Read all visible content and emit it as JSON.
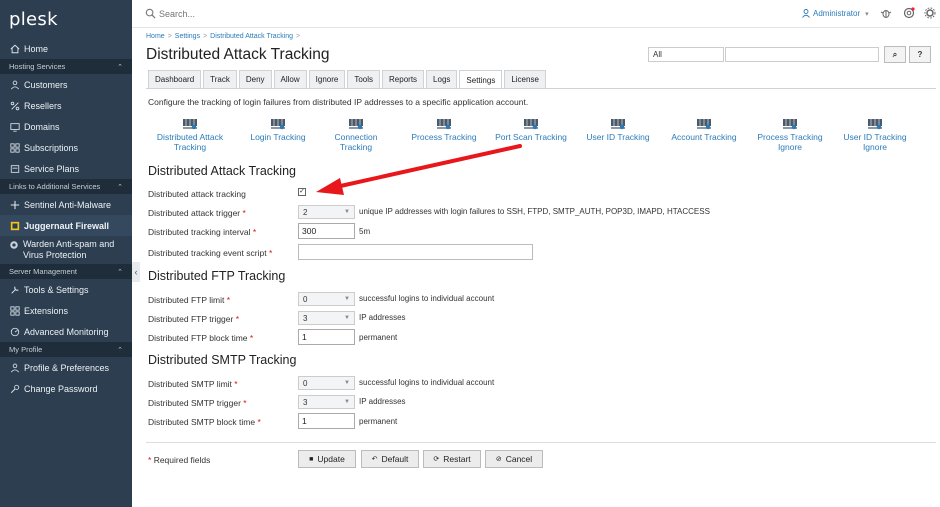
{
  "sidebar": {
    "logo": "plesk",
    "items": [
      {
        "type": "item",
        "label": "Home",
        "icon": "home-icon"
      },
      {
        "type": "section",
        "label": "Hosting Services"
      },
      {
        "type": "item",
        "label": "Customers",
        "icon": "user-icon"
      },
      {
        "type": "item",
        "label": "Resellers",
        "icon": "percent-icon"
      },
      {
        "type": "item",
        "label": "Domains",
        "icon": "monitor-icon"
      },
      {
        "type": "item",
        "label": "Subscriptions",
        "icon": "grid-icon"
      },
      {
        "type": "item",
        "label": "Service Plans",
        "icon": "document-icon"
      },
      {
        "type": "section",
        "label": "Links to Additional Services"
      },
      {
        "type": "item",
        "label": "Sentinel Anti-Malware",
        "icon": "shield-icon"
      },
      {
        "type": "item",
        "label": "Juggernaut Firewall",
        "icon": "firewall-icon",
        "active": true
      },
      {
        "type": "item",
        "label": "Warden Anti-spam and Virus Protection",
        "icon": "warden-icon",
        "tall": true
      },
      {
        "type": "section",
        "label": "Server Management"
      },
      {
        "type": "item",
        "label": "Tools & Settings",
        "icon": "tools-icon"
      },
      {
        "type": "item",
        "label": "Extensions",
        "icon": "extensions-icon"
      },
      {
        "type": "item",
        "label": "Advanced Monitoring",
        "icon": "monitoring-icon"
      },
      {
        "type": "section",
        "label": "My Profile"
      },
      {
        "type": "item",
        "label": "Profile & Preferences",
        "icon": "profile-icon"
      },
      {
        "type": "item",
        "label": "Change Password",
        "icon": "key-icon"
      }
    ],
    "collapse_glyph": "‹"
  },
  "topbar": {
    "search_placeholder": "Search...",
    "user": "Administrator",
    "user_caret": "▾"
  },
  "breadcrumb": [
    "Home",
    "Settings",
    "Distributed Attack Tracking"
  ],
  "breadcrumb_sep": ">",
  "page_title": "Distributed Attack Tracking",
  "filter": {
    "select": "All",
    "search_btn": "⌕",
    "help_btn": "?"
  },
  "tabs": [
    "Dashboard",
    "Track",
    "Deny",
    "Allow",
    "Ignore",
    "Tools",
    "Reports",
    "Logs",
    "Settings",
    "License"
  ],
  "active_tab": "Settings",
  "description": "Configure the tracking of login failures from distributed IP addresses to a specific application account.",
  "icon_links": [
    {
      "label": "Distributed Attack Tracking"
    },
    {
      "label": "Login Tracking"
    },
    {
      "label": "Connection Tracking"
    },
    {
      "label": "Process Tracking"
    },
    {
      "label": "Port Scan Tracking"
    },
    {
      "label": "User ID Tracking"
    },
    {
      "label": "Account Tracking"
    },
    {
      "label": "Process Tracking Ignore"
    },
    {
      "label": "User ID Tracking Ignore"
    }
  ],
  "sections": {
    "dat": {
      "title": "Distributed Attack Tracking",
      "tracking_label": "Distributed attack tracking",
      "tracking_checked": true,
      "check_glyph": "✓",
      "trigger_label": "Distributed attack trigger",
      "trigger_value": "2",
      "trigger_after": "unique IP addresses with login failures to SSH, FTPD, SMTP_AUTH, POP3D, IMAPD, HTACCESS",
      "interval_label": "Distributed tracking interval",
      "interval_value": "300",
      "interval_after": "5m",
      "script_label": "Distributed tracking event script",
      "script_value": ""
    },
    "ftp": {
      "title": "Distributed FTP Tracking",
      "limit_label": "Distributed FTP limit",
      "limit_value": "0",
      "limit_after": "successful logins to individual account",
      "trigger_label": "Distributed FTP trigger",
      "trigger_value": "3",
      "trigger_after": "IP addresses",
      "block_label": "Distributed FTP block time",
      "block_value": "1",
      "block_after": "permanent"
    },
    "smtp": {
      "title": "Distributed SMTP Tracking",
      "limit_label": "Distributed SMTP limit",
      "limit_value": "0",
      "limit_after": "successful logins to individual account",
      "trigger_label": "Distributed SMTP trigger",
      "trigger_value": "3",
      "trigger_after": "IP addresses",
      "block_label": "Distributed SMTP block time",
      "block_value": "1",
      "block_after": "permanent"
    }
  },
  "required_mark": "*",
  "required_note": "Required fields",
  "buttons": {
    "update": "Update",
    "default": "Default",
    "restart": "Restart",
    "cancel": "Cancel"
  },
  "colors": {
    "sidebar_bg": "#2c3e50",
    "link": "#2b7bb9",
    "required": "#dd1111",
    "arrow": "#e8171b"
  }
}
